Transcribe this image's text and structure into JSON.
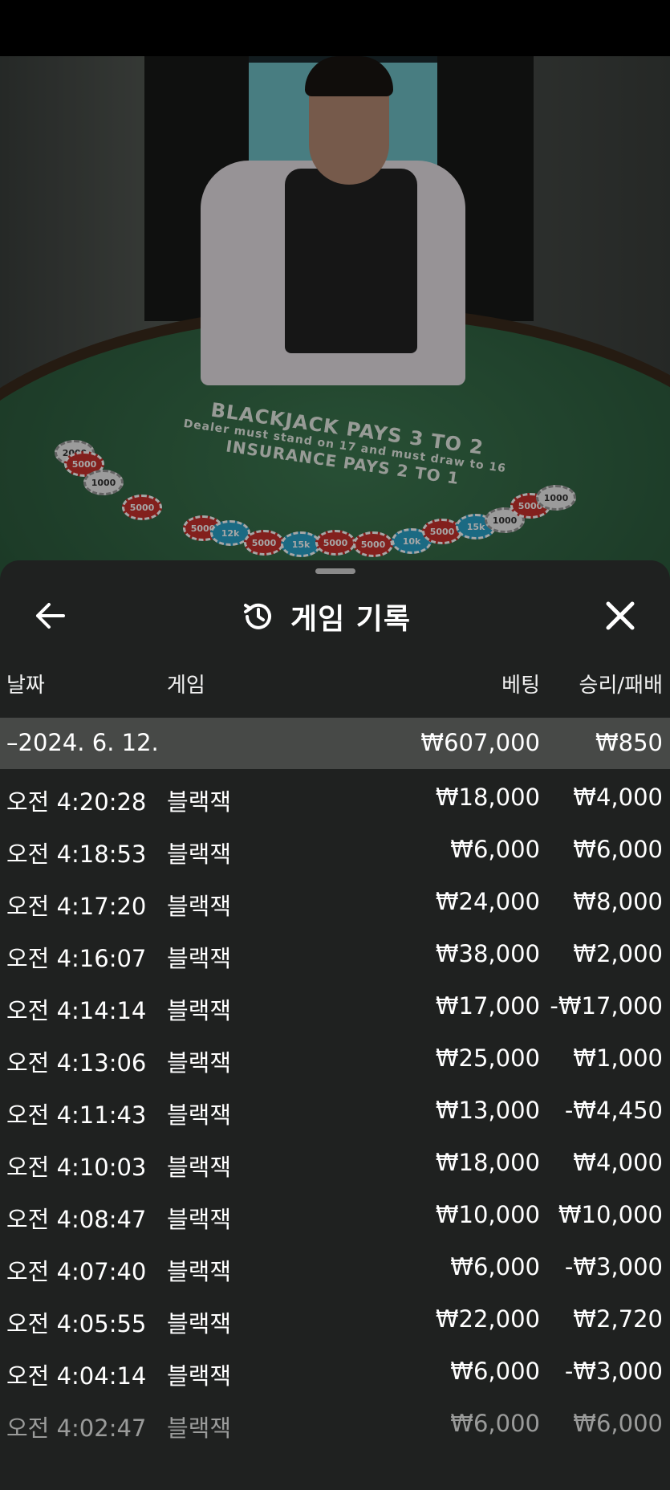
{
  "table_text": {
    "line1": "BLACKJACK PAYS 3 TO 2",
    "line2": "Dealer must stand on 17 and must draw to 16",
    "line3": "INSURANCE PAYS 2 TO 1"
  },
  "chips": [
    "2000",
    "5000",
    "1000",
    "5000",
    "5000",
    "12k",
    "5000",
    "15k",
    "5000",
    "5000",
    "10k",
    "5000",
    "15k",
    "1000",
    "5000",
    "1000"
  ],
  "header": {
    "back_icon": "arrow-left-icon",
    "history_icon": "history-clock-icon",
    "title": "게임 기록",
    "close_icon": "close-x-icon"
  },
  "columns": {
    "date": "날짜",
    "game": "게임",
    "bet": "베팅",
    "win_loss": "승리/패배"
  },
  "date_group": {
    "date": "–2024. 6. 12.",
    "bet_total": "₩607,000",
    "win_total": "₩850"
  },
  "rows": [
    {
      "time": "오전 4:20:28",
      "game": "블랙잭",
      "bet": "₩18,000",
      "result": "₩4,000"
    },
    {
      "time": "오전 4:18:53",
      "game": "블랙잭",
      "bet": "₩6,000",
      "result": "₩6,000"
    },
    {
      "time": "오전 4:17:20",
      "game": "블랙잭",
      "bet": "₩24,000",
      "result": "₩8,000"
    },
    {
      "time": "오전 4:16:07",
      "game": "블랙잭",
      "bet": "₩38,000",
      "result": "₩2,000"
    },
    {
      "time": "오전 4:14:14",
      "game": "블랙잭",
      "bet": "₩17,000",
      "result": "-₩17,000"
    },
    {
      "time": "오전 4:13:06",
      "game": "블랙잭",
      "bet": "₩25,000",
      "result": "₩1,000"
    },
    {
      "time": "오전 4:11:43",
      "game": "블랙잭",
      "bet": "₩13,000",
      "result": "-₩4,450"
    },
    {
      "time": "오전 4:10:03",
      "game": "블랙잭",
      "bet": "₩18,000",
      "result": "₩4,000"
    },
    {
      "time": "오전 4:08:47",
      "game": "블랙잭",
      "bet": "₩10,000",
      "result": "₩10,000"
    },
    {
      "time": "오전 4:07:40",
      "game": "블랙잭",
      "bet": "₩6,000",
      "result": "-₩3,000"
    },
    {
      "time": "오전 4:05:55",
      "game": "블랙잭",
      "bet": "₩22,000",
      "result": "₩2,720"
    },
    {
      "time": "오전 4:04:14",
      "game": "블랙잭",
      "bet": "₩6,000",
      "result": "-₩3,000"
    },
    {
      "time": "오전 4:02:47",
      "game": "블랙잭",
      "bet": "₩6,000",
      "result": "₩6,000"
    }
  ]
}
